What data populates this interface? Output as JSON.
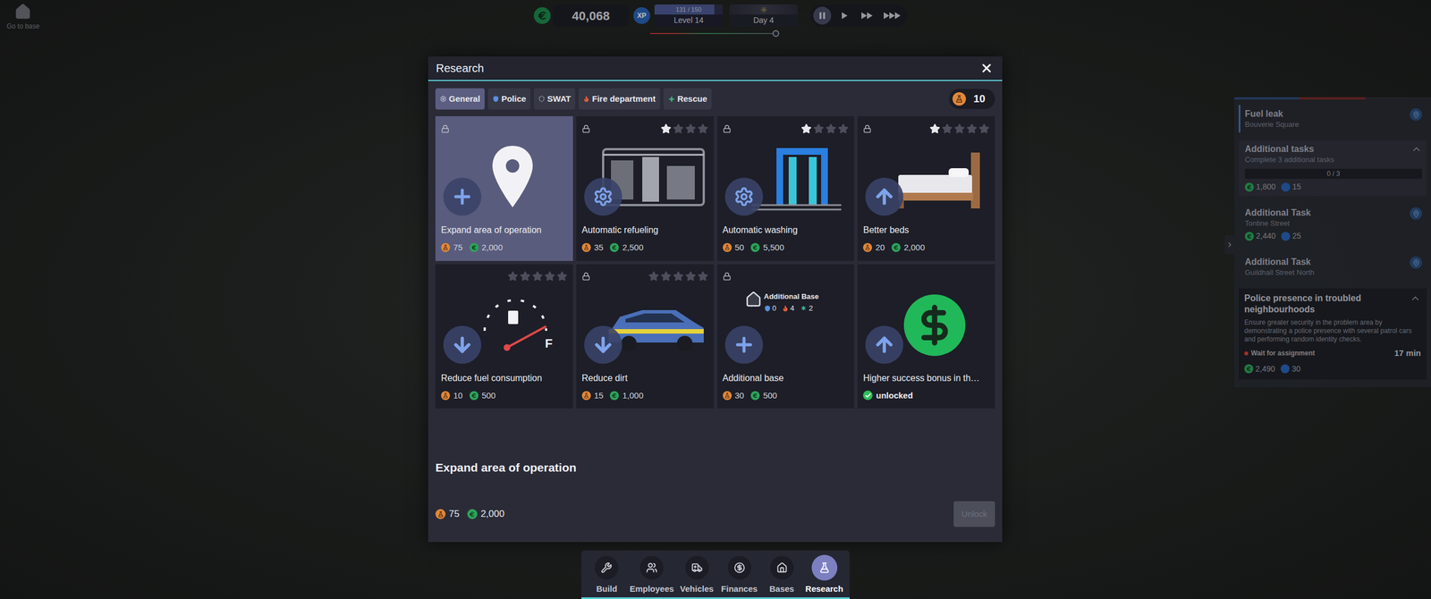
{
  "go_to_base": "Go to base",
  "top_bar": {
    "money": "40,068",
    "xp_label": "XP",
    "xp": "131 / 150",
    "xp_level": 0.873,
    "level": "Level 14",
    "day": "Day 4",
    "day_progress": 0.98,
    "speeds": [
      {
        "kind": "pause",
        "selected": true
      },
      {
        "kind": "play",
        "selected": false
      },
      {
        "kind": "fast",
        "selected": false
      },
      {
        "kind": "fastest",
        "selected": false
      }
    ]
  },
  "research": {
    "title": "Research",
    "tabs": [
      {
        "label": "General",
        "kind": "general",
        "selected": true
      },
      {
        "label": "Police",
        "kind": "police",
        "selected": false
      },
      {
        "label": "SWAT",
        "kind": "swat",
        "selected": false
      },
      {
        "label": "Fire department",
        "kind": "fire",
        "selected": false
      },
      {
        "label": "Rescue",
        "kind": "rescue",
        "selected": false
      }
    ],
    "points": "10",
    "cards": [
      {
        "title": "Expand area of operation",
        "kind": "expand",
        "locked": true,
        "selected": true,
        "stars": 0,
        "max_stars": 0,
        "points": "75",
        "money": "2,000"
      },
      {
        "title": "Automatic refueling",
        "kind": "refuel",
        "locked": true,
        "selected": false,
        "stars": 1,
        "max_stars": 4,
        "points": "35",
        "money": "2,500"
      },
      {
        "title": "Automatic washing",
        "kind": "wash",
        "locked": true,
        "selected": false,
        "stars": 1,
        "max_stars": 4,
        "points": "50",
        "money": "5,500"
      },
      {
        "title": "Better beds",
        "kind": "beds",
        "locked": true,
        "selected": false,
        "stars": 1,
        "max_stars": 5,
        "points": "20",
        "money": "2,000"
      },
      {
        "title": "Reduce fuel consumption",
        "kind": "fuel",
        "locked": false,
        "selected": false,
        "stars": 0,
        "max_stars": 5,
        "points": "10",
        "money": "500"
      },
      {
        "title": "Reduce dirt",
        "kind": "dirt",
        "locked": true,
        "selected": false,
        "stars": 0,
        "max_stars": 5,
        "points": "15",
        "money": "1,000"
      },
      {
        "title": "Additional base",
        "kind": "base",
        "locked": true,
        "selected": false,
        "stars": 0,
        "max_stars": 0,
        "points": "30",
        "money": "500",
        "preview": {
          "title": "Additional Base",
          "counts": [
            {
              "kind": "police",
              "value": "0"
            },
            {
              "kind": "fire",
              "value": "4"
            },
            {
              "kind": "rescue",
              "value": "2"
            }
          ]
        }
      },
      {
        "title": "Higher success bonus in th…",
        "kind": "bonus",
        "locked": false,
        "selected": false,
        "stars": 0,
        "max_stars": 0,
        "status": "unlocked"
      }
    ],
    "detail": {
      "title": "Expand area of operation",
      "points": "75",
      "money": "2,000",
      "button": "Unlock",
      "disabled": true
    }
  },
  "missions": {
    "items": [
      {
        "kind": "task",
        "title": "Fuel leak",
        "subtitle": "Bouverie Square",
        "selected": true
      },
      {
        "kind": "group",
        "title": "Additional tasks",
        "subtitle": "Complete 3 additional tasks",
        "progress": "0 / 3",
        "level": 0,
        "reward": "1,800",
        "xp": "15",
        "expanded": true,
        "selected": false
      },
      {
        "kind": "task",
        "title": "Additional Task",
        "subtitle": "Tontine Street",
        "reward": "2,440",
        "xp": "25",
        "selected": false
      },
      {
        "kind": "task",
        "title": "Additional Task",
        "subtitle": "Guildhall Street North",
        "selected": false
      }
    ],
    "popup": {
      "title": "Police presence in troubled neighbourhoods",
      "description": "Ensure greater security in the problem area by demonstrating a police presence with several patrol cars and performing random identity checks.",
      "status": "Wait for assignment",
      "time": "17 min",
      "reward": "2,490",
      "xp": "30",
      "expanded": true
    }
  },
  "nav": [
    {
      "label": "Build",
      "kind": "build",
      "selected": false
    },
    {
      "label": "Employees",
      "kind": "employees",
      "selected": false
    },
    {
      "label": "Vehicles",
      "kind": "vehicles",
      "selected": false
    },
    {
      "label": "Finances",
      "kind": "finances",
      "selected": false
    },
    {
      "label": "Bases",
      "kind": "bases",
      "selected": false
    },
    {
      "label": "Research",
      "kind": "research",
      "selected": true
    }
  ]
}
